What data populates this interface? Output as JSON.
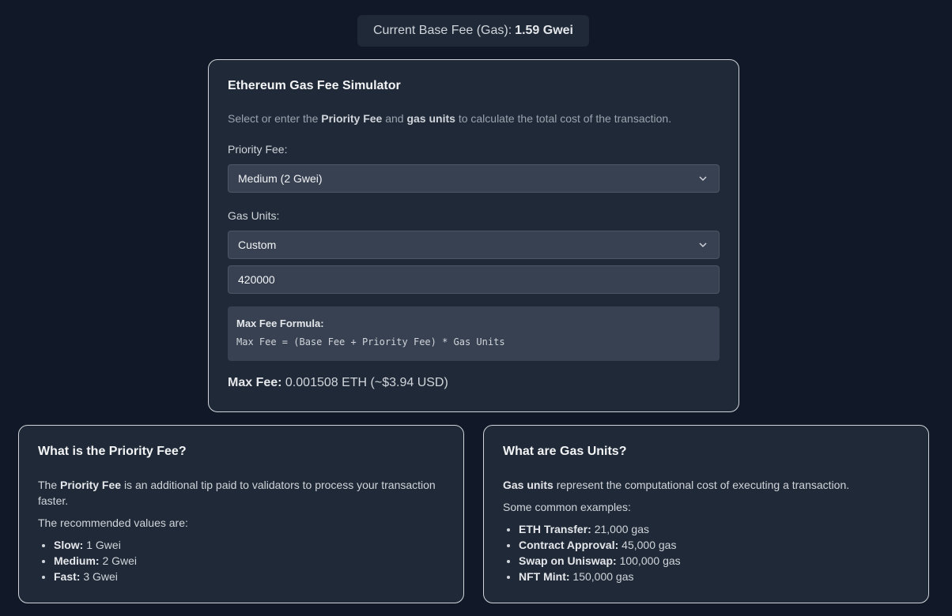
{
  "header": {
    "base_fee_label": "Current Base Fee (Gas):",
    "base_fee_value": "1.59 Gwei"
  },
  "simulator": {
    "title": "Ethereum Gas Fee Simulator",
    "desc_prefix": "Select or enter the",
    "desc_bold1": "Priority Fee",
    "desc_mid": "and",
    "desc_bold2": "gas units",
    "desc_suffix": "to calculate the total cost of the transaction.",
    "priority_label": "Priority Fee:",
    "priority_selected": "Medium (2 Gwei)",
    "gas_label": "Gas Units:",
    "gas_selected": "Custom",
    "gas_input_value": "420000",
    "formula_title": "Max Fee Formula:",
    "formula_code": "Max Fee = (Base Fee + Priority Fee) * Gas Units",
    "max_fee_label": "Max Fee:",
    "max_fee_value": "0.001508 ETH (~$3.94 USD)"
  },
  "priority_info": {
    "title": "What is the Priority Fee?",
    "p1_prefix": "The",
    "p1_bold": "Priority Fee",
    "p1_suffix": "is an additional tip paid to validators to process your transaction faster.",
    "p2": "The recommended values are:",
    "items": [
      {
        "label": "Slow:",
        "value": "1 Gwei"
      },
      {
        "label": "Medium:",
        "value": "2 Gwei"
      },
      {
        "label": "Fast:",
        "value": "3 Gwei"
      }
    ]
  },
  "gas_info": {
    "title": "What are Gas Units?",
    "p1_bold": "Gas units",
    "p1_suffix": "represent the computational cost of executing a transaction.",
    "p2": "Some common examples:",
    "items": [
      {
        "label": "ETH Transfer:",
        "value": "21,000 gas"
      },
      {
        "label": "Contract Approval:",
        "value": "45,000 gas"
      },
      {
        "label": "Swap on Uniswap:",
        "value": "100,000 gas"
      },
      {
        "label": "NFT Mint:",
        "value": "150,000 gas"
      }
    ]
  }
}
